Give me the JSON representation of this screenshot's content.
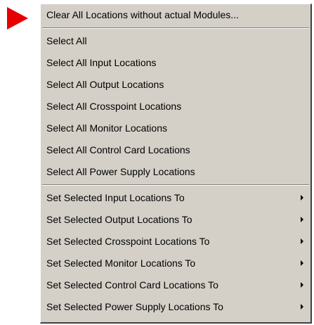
{
  "menu": {
    "clear_item": "Clear All Locations without actual Modules...",
    "select_items": [
      "Select All",
      "Select All Input  Locations",
      "Select All Output Locations",
      "Select All Crosspoint Locations",
      "Select All Monitor Locations",
      "Select All Control Card Locations",
      "Select All Power Supply Locations"
    ],
    "set_items": [
      "Set Selected Input  Locations To",
      "Set Selected Output Locations To",
      "Set Selected Crosspoint Locations To",
      "Set Selected Monitor Locations To",
      "Set Selected Control Card Locations To",
      "Set Selected Power Supply Locations To"
    ]
  },
  "colors": {
    "pointer": "#e60000",
    "menu_bg": "#d4d0c8"
  }
}
